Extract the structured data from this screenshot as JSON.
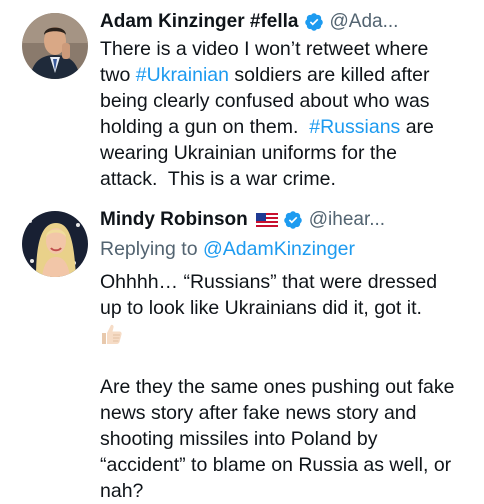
{
  "tweets": [
    {
      "author": {
        "name": "Adam Kinzinger #fella",
        "handle": "@Ada...",
        "verified": true,
        "avatar_icon": "portrait-man-suit-icon"
      },
      "lines": [
        [
          {
            "t": "There is a video I won’t retweet where"
          }
        ],
        [
          {
            "t": "two "
          },
          {
            "t": "#Ukrainian",
            "link": true
          },
          {
            "t": " soldiers are killed after"
          }
        ],
        [
          {
            "t": "being clearly confused about who was"
          }
        ],
        [
          {
            "t": "holding a gun on them.  "
          },
          {
            "t": "#Russians",
            "link": true
          },
          {
            "t": " are"
          }
        ],
        [
          {
            "t": "wearing Ukrainian uniforms for the"
          }
        ],
        [
          {
            "t": "attack.  This is a war crime."
          }
        ]
      ]
    },
    {
      "author": {
        "name": "Mindy Robinson",
        "handle": "@ihear...",
        "verified": true,
        "flag_icon": "us-flag-icon",
        "avatar_icon": "portrait-woman-blonde-icon"
      },
      "replying_prefix": "Replying to ",
      "replying_handle": "@AdamKinzinger",
      "lines": [
        [
          {
            "t": "Ohhhh… “Russians” that were dressed"
          }
        ],
        [
          {
            "t": "up to look like Ukrainians did it, got it."
          }
        ],
        [
          {
            "emoji": "thumbs-up-icon"
          }
        ],
        [
          {
            "t": ""
          }
        ],
        [
          {
            "t": "Are they the same ones pushing out fake"
          }
        ],
        [
          {
            "t": "news story after fake news story and"
          }
        ],
        [
          {
            "t": "shooting missiles into Poland by"
          }
        ],
        [
          {
            "t": "“accident” to blame on Russia as well, or"
          }
        ],
        [
          {
            "t": "nah?"
          }
        ]
      ]
    }
  ],
  "colors": {
    "text": "#0f1419",
    "secondary": "#536471",
    "link": "#1d9bf0",
    "verified": "#1d9bf0"
  }
}
